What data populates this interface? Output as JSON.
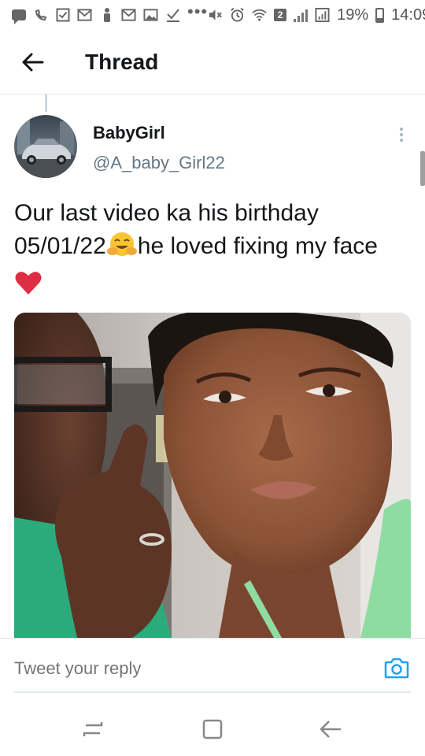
{
  "status_bar": {
    "sim_slot": "2",
    "battery_percent": "19%",
    "time": "14:09",
    "icons": [
      "message-icon",
      "missed-call-icon",
      "checkbox-icon",
      "mail-icon",
      "person-icon",
      "mail-icon",
      "image-icon",
      "download-icon",
      "more-dots-icon",
      "mute-icon",
      "alarm-icon",
      "wifi-icon",
      "sim-icon",
      "signal-icon",
      "battery-icon"
    ]
  },
  "header": {
    "title": "Thread",
    "back_icon": "arrow-left-icon"
  },
  "tweet": {
    "display_name": "BabyGirl",
    "handle": "@A_baby_Girl22",
    "text_part1": "Our last video ka his birthday 05/01/22",
    "text_part2": "he loved fixing my face ",
    "emoji_hug": "hugging-face-emoji",
    "emoji_heart": "red-heart-emoji",
    "media_type": "video-thumbnail"
  },
  "reply": {
    "placeholder": "Tweet your reply",
    "camera_icon": "camera-icon"
  },
  "nav_bar": {
    "buttons": [
      "recent-apps-icon",
      "home-icon",
      "back-icon"
    ]
  },
  "colors": {
    "text_primary": "#14171a",
    "text_secondary": "#657786",
    "accent": "#1da1f2",
    "divider": "#e1e8ed"
  }
}
